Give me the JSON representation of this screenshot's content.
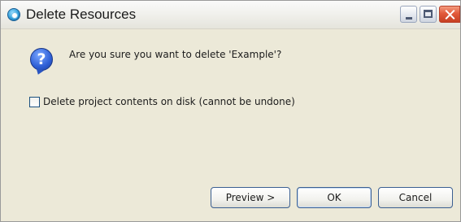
{
  "window": {
    "title": "Delete Resources",
    "title_icon": "eclipse-app-icon",
    "controls": [
      "minimize-icon",
      "maximize-icon",
      "close-icon"
    ]
  },
  "dialog": {
    "icon": "question-icon",
    "icon_glyph": "?",
    "message": "Are you sure you want to delete 'Example'?",
    "checkbox": {
      "label": "Delete project contents on disk (cannot be undone)",
      "checked": false
    }
  },
  "buttons": {
    "preview": "Preview >",
    "ok": "OK",
    "cancel": "Cancel"
  },
  "colors": {
    "dialog_bg": "#ece9d8",
    "button_border": "#3b5f91",
    "close_button": "#e2593a"
  }
}
